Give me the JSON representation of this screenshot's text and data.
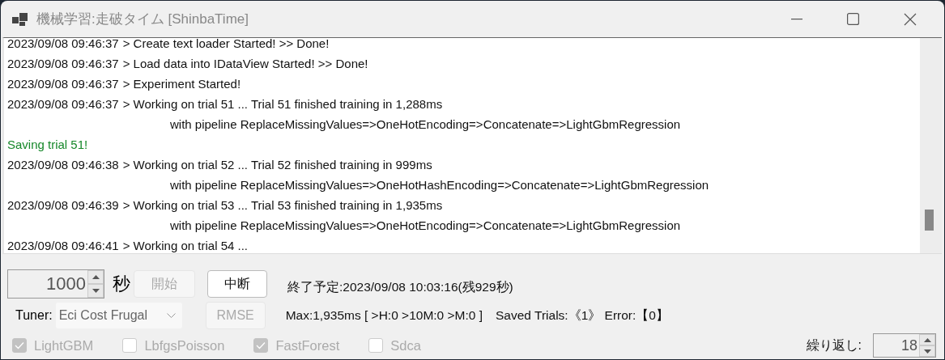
{
  "window": {
    "title": "機械学習:走破タイム [ShinbaTime]"
  },
  "log": [
    {
      "kind": "entry",
      "time": "2023/09/08 09:46:37",
      "text": "> Create text loader Started! >> Done!"
    },
    {
      "kind": "entry",
      "time": "2023/09/08 09:46:37",
      "text": "> Load data into IDataView Started! >> Done!"
    },
    {
      "kind": "entry",
      "time": "2023/09/08 09:46:37",
      "text": "> Experiment Started!"
    },
    {
      "kind": "entry",
      "time": "2023/09/08 09:46:37",
      "text": "> Working on trial 51 ... Trial 51 finished training in 1,288ms"
    },
    {
      "kind": "detail",
      "text": "with pipeline ReplaceMissingValues=>OneHotEncoding=>Concatenate=>LightGbmRegression"
    },
    {
      "kind": "saved",
      "text": "Saving trial 51!"
    },
    {
      "kind": "entry",
      "time": "2023/09/08 09:46:38",
      "text": "> Working on trial 52 ... Trial 52 finished training in 999ms"
    },
    {
      "kind": "detail",
      "text": "with pipeline ReplaceMissingValues=>OneHotHashEncoding=>Concatenate=>LightGbmRegression"
    },
    {
      "kind": "entry",
      "time": "2023/09/08 09:46:39",
      "text": "> Working on trial 53 ... Trial 53 finished training in 1,935ms"
    },
    {
      "kind": "detail",
      "text": "with pipeline ReplaceMissingValues=>OneHotEncoding=>Concatenate=>LightGbmRegression"
    },
    {
      "kind": "entry",
      "time": "2023/09/08 09:46:41",
      "text": "> Working on trial 54 ..."
    }
  ],
  "duration": {
    "value": "1000",
    "unit": "秒"
  },
  "start_button": {
    "label": "開始",
    "disabled": true
  },
  "stop_button": {
    "label": "中断",
    "disabled": false
  },
  "eta": "終了予定:2023/09/08 10:03:16(残929秒)",
  "tuner": {
    "label": "Tuner:",
    "value": "Eci Cost Frugal",
    "disabled": true
  },
  "metric_button": {
    "label": "RMSE",
    "disabled": true
  },
  "stats": "Max:1,935ms [ >H:0 >10M:0 >M:0 ]　Saved Trials:《1》 Error:【0】",
  "trainers": [
    {
      "label": "LightGBM",
      "checked": true,
      "disabled": true
    },
    {
      "label": "LbfgsPoisson",
      "checked": false,
      "disabled": true
    },
    {
      "label": "FastForest",
      "checked": true,
      "disabled": true
    },
    {
      "label": "Sdca",
      "checked": false,
      "disabled": true
    }
  ],
  "repeat": {
    "label": "繰り返し:",
    "value": "18"
  }
}
